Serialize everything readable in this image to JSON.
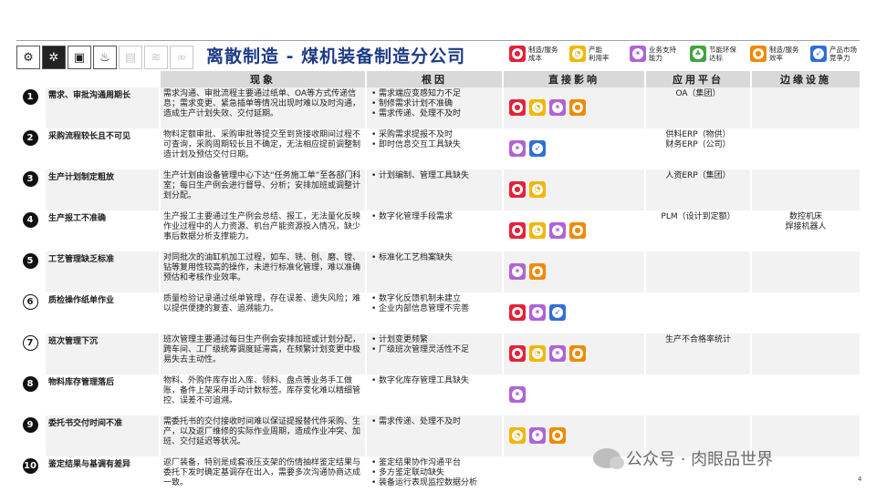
{
  "title": "离散制造 - 煤机装备制造分公司",
  "page_number": "4",
  "watermark": "公众号 · 肉眼品世界",
  "legend": [
    {
      "label": "制造/服务\n成本",
      "color": "#e3233a",
      "icon": "shopping-bag-icon"
    },
    {
      "label": "产能\n利用率",
      "color": "#f2b705",
      "icon": "gauge-icon"
    },
    {
      "label": "业务支持\n能力",
      "color": "#b063d6",
      "icon": "gear-icon"
    },
    {
      "label": "节能环保\n达标",
      "color": "#42a540",
      "icon": "leaf-icon"
    },
    {
      "label": "制造/服务\n效率",
      "color": "#f08a00",
      "icon": "lightbulb-icon"
    },
    {
      "label": "产品市场\n竞争力",
      "color": "#2f6fd6",
      "icon": "rocket-icon"
    }
  ],
  "columns": {
    "phenomenon": "现象",
    "cause": "根因",
    "impact": "直接影响",
    "app": "应用平台",
    "edge": "边缘设施"
  },
  "rows": [
    {
      "num": "1",
      "style": "solid",
      "problem": "需求、审批沟通周期长",
      "phenomenon": "需求沟通、审批流程主要通过纸单、OA等方式传递信息；需求变更、紧急插单等情况出现时难以及时沟通，造成生产计划失效、交付延期。",
      "causes": [
        "需求端应变感知力不足",
        "制修需求计划不准确",
        "需求传递、处理不及时"
      ],
      "impacts": [
        "red",
        "yel",
        "pur",
        "org"
      ],
      "app": "OA（集团）",
      "edge": ""
    },
    {
      "num": "2",
      "style": "solid",
      "problem": "采购流程较长且不可见",
      "phenomenon": "物料定额审批、采购审批等提交至到货接收期间过程不可查询，采购周期较长且不确定，无法相应提前调整制造计划及预估交付日期。",
      "causes": [
        "采购需求提报不及时",
        "即时信息交互工具缺失"
      ],
      "impacts": [
        "pur",
        "blu"
      ],
      "app": "供料ERP（物供）\n财务ERP（公司）",
      "edge": ""
    },
    {
      "num": "3",
      "style": "solid",
      "problem": "生产计划制定粗放",
      "phenomenon": "生产计划由设备管理中心下达“任务施工单”至各部门科室；每日生产例会进行督导、分析；安排加班或调整计划分配。",
      "causes": [
        "计划编制、管理工具缺失"
      ],
      "impacts": [
        "red",
        "yel"
      ],
      "app": "人资ERP（集团）",
      "edge": ""
    },
    {
      "num": "4",
      "style": "solid",
      "problem": "生产报工不准确",
      "phenomenon": "生产报工主要通过生产例会总结、报工，无法量化反映作业过程中的人力资源、机台产能资源投入情况，缺少事后数据分析支撑能力。",
      "causes": [
        "数字化管理手段需求"
      ],
      "impacts": [
        "red",
        "yel",
        "pur",
        "org"
      ],
      "app": "PLM（设计到定额）",
      "edge": "数控机床\n焊接机器人"
    },
    {
      "num": "5",
      "style": "solid",
      "problem": "工艺管理缺乏标准",
      "phenomenon": "对同批次的油缸机加工过程，如车、铣、刨、磨、镗、钻等复用性较高的操作，未进行标准化管理，难以准确预估和考核作业效率。",
      "causes": [
        "标准化工艺档案缺失"
      ],
      "impacts": [
        "pur",
        "org"
      ],
      "app": "",
      "edge": ""
    },
    {
      "num": "6",
      "style": "outline",
      "problem": "质检操作纸单作业",
      "phenomenon": "质量检验记录通过纸单管理，存在误差、遗失风险；难以提供便捷的复查、追溯能力。",
      "causes": [
        "数字化反馈机制未建立",
        "企业内部信息管理不完善"
      ],
      "impacts": [
        "red",
        "pur",
        "blu"
      ],
      "app": "",
      "edge": ""
    },
    {
      "num": "7",
      "style": "outline",
      "problem": "班次管理下沉",
      "phenomenon": "班次管理主要通过每日生产例会安排加班或计划分配，跨车间、工厂级统筹调度延滞高，在频繁计划变更中极易失去主动性。",
      "causes": [
        "计划变更频繁",
        "厂级班次管理灵活性不足"
      ],
      "impacts": [
        "red",
        "yel",
        "pur",
        "org"
      ],
      "app": "生产不合格率统计",
      "edge": ""
    },
    {
      "num": "8",
      "style": "solid",
      "problem": "物料库存管理落后",
      "phenomenon": "物料、外购件库存出入库、领料、盘点等业务手工做账，备件上架采用手动计数标签。库存变化难以精细管控、误差不可追溯。",
      "causes": [
        "数字化库存管理工具缺失"
      ],
      "impacts": [
        "pur"
      ],
      "app": "",
      "edge": ""
    },
    {
      "num": "9",
      "style": "solid",
      "problem": "委托书交付时间不准",
      "phenomenon": "需委托书的交付接收时间难以保证提报替代件采购、生产，以及返厂维修的实际作业周期，造成作业冲突、加班、交付延迟等状况。",
      "causes": [
        "需求传递、处理不及时"
      ],
      "impacts": [
        "yel",
        "pur",
        "org"
      ],
      "app": "",
      "edge": ""
    },
    {
      "num": "10",
      "style": "solid",
      "problem": "鉴定结果与基调有差异",
      "phenomenon": "返厂装备，特别是成套液压支架的伤情抽样鉴定结果与委托下发时确定基调存在出入，需要多次沟通协商达成一致。",
      "causes": [
        "鉴定结果协作沟通平台",
        "多方鉴定联动缺失",
        "装备运行表现监控数据分析"
      ],
      "impacts": [],
      "app": "",
      "edge": ""
    }
  ]
}
